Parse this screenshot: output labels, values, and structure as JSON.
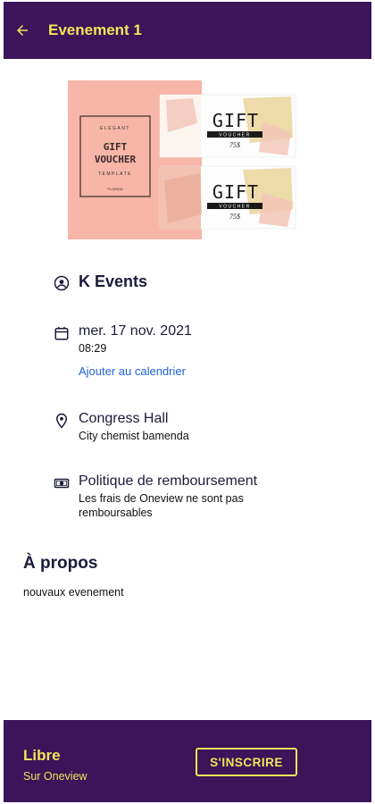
{
  "appbar": {
    "title": "Evenement 1"
  },
  "hero": {
    "left_card": {
      "line1": "ELEGANT",
      "line2": "GIFT",
      "line3": "VOUCHER",
      "line4": "TEMPLATE",
      "line5": "FLORIDA"
    },
    "voucher_top": {
      "title": "GIFT",
      "subtitle": "VOUCHER",
      "amount": "75$"
    },
    "voucher_bottom": {
      "title": "GIFT",
      "subtitle": "VOUCHER",
      "amount": "75$"
    }
  },
  "organizer": {
    "name": "K Events"
  },
  "date": {
    "date": "mer. 17 nov. 2021",
    "time": "08:29",
    "add_calendar": "Ajouter au calendrier"
  },
  "location": {
    "venue": "Congress Hall",
    "address": "City chemist bamenda"
  },
  "refund": {
    "title": "Politique de remboursement",
    "text": "Les frais de Oneview ne sont pas remboursables"
  },
  "about": {
    "title": "À propos",
    "text": "nouvaux evenement"
  },
  "footer": {
    "price": "Libre",
    "platform": "Sur Oneview",
    "register_label": "S'INSCRIRE"
  },
  "colors": {
    "brand": "#3b1459",
    "accent": "#f3e55a",
    "link": "#1f63d6"
  }
}
